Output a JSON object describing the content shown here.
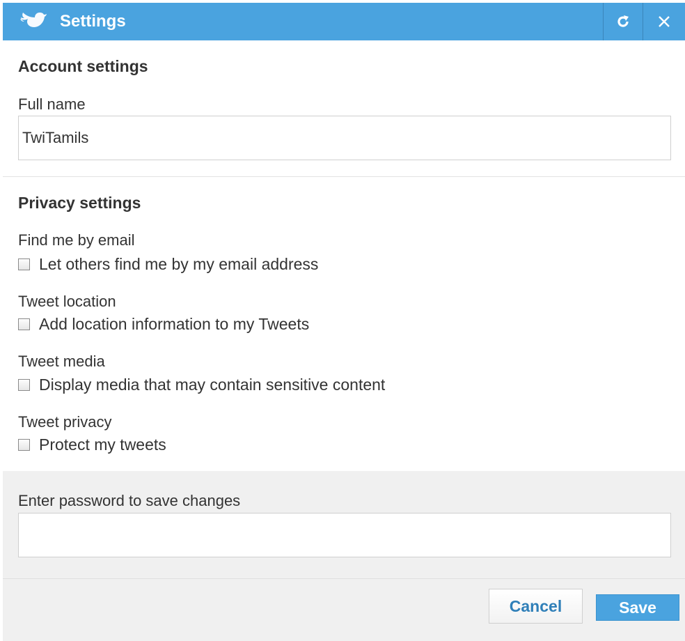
{
  "window": {
    "title": "Settings",
    "colors": {
      "titlebar": "#4aa3df",
      "accent_text": "#2f7fb8"
    }
  },
  "account": {
    "heading": "Account settings",
    "full_name_label": "Full name",
    "full_name_value": "TwiTamils"
  },
  "privacy": {
    "heading": "Privacy settings",
    "options": [
      {
        "label": "Find me by email",
        "checkbox": "Let others find me by my email address",
        "checked": false
      },
      {
        "label": "Tweet location",
        "checkbox": "Add location information to my Tweets",
        "checked": false
      },
      {
        "label": "Tweet media",
        "checkbox": "Display media that may contain sensitive content",
        "checked": false
      },
      {
        "label": "Tweet privacy",
        "checkbox": "Protect my tweets",
        "checked": false
      }
    ]
  },
  "password": {
    "label": "Enter password to save changes",
    "value": ""
  },
  "buttons": {
    "cancel": "Cancel",
    "save": "Save"
  }
}
